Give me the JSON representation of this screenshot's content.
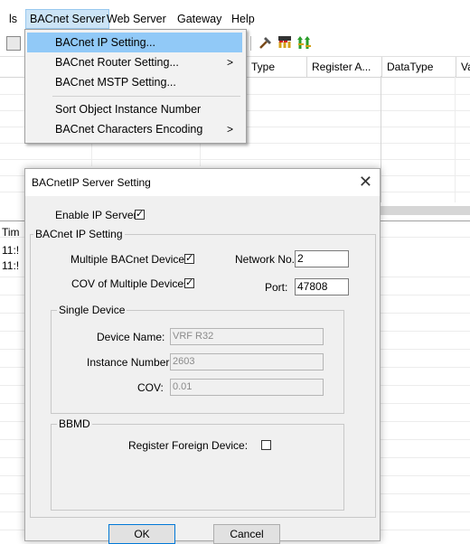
{
  "menubar": {
    "items": [
      "ls",
      "BACnet Server",
      "Web Server",
      "Gateway",
      "Help"
    ]
  },
  "grid": {
    "columns": [
      "Type",
      "Register A...",
      "DataType",
      "Va"
    ],
    "left_header": "Tim",
    "left_rows": [
      "11:!",
      "11:!"
    ]
  },
  "dropdown": {
    "items": [
      {
        "label": "BACnet IP Setting..."
      },
      {
        "label": "BACnet Router Setting...",
        "arrow": ">"
      },
      {
        "label": "BACnet MSTP Setting..."
      },
      {
        "label": "Sort Object Instance Number"
      },
      {
        "label": "BACnet Characters Encoding",
        "arrow": ">"
      }
    ]
  },
  "dialog": {
    "title": "BACnetIP Server Setting",
    "close_glyph": "✕",
    "enable_ip_server": {
      "label": "Enable IP Server:",
      "checked": true
    },
    "ip_group": {
      "title": "BACnet IP Setting",
      "multiple_devices": {
        "label": "Multiple BACnet Devices:",
        "checked": true
      },
      "cov_multiple": {
        "label": "COV of Multiple Devices:",
        "checked": true
      },
      "network_no": {
        "label": "Network No.:",
        "value": "2"
      },
      "port": {
        "label": "Port:",
        "value": "47808"
      }
    },
    "single_group": {
      "title": "Single Device",
      "device_name": {
        "label": "Device Name:",
        "value": "VRF R32"
      },
      "instance_number": {
        "label": "Instance Number:",
        "value": "2603"
      },
      "cov": {
        "label": "COV:",
        "value": "0.01"
      }
    },
    "bbmd_group": {
      "title": "BBMD",
      "register_foreign": {
        "label": "Register Foreign Device:",
        "checked": false
      }
    },
    "ok_label": "OK",
    "cancel_label": "Cancel"
  },
  "check_glyph": "✓",
  "icons": [
    "grid-icon",
    "tools-icon",
    "load-icon",
    "up-icon"
  ],
  "colors": {
    "highlight": "#91c9f7",
    "menu_active": "#cce4f7",
    "dialog_bg": "#f0f0f0"
  }
}
